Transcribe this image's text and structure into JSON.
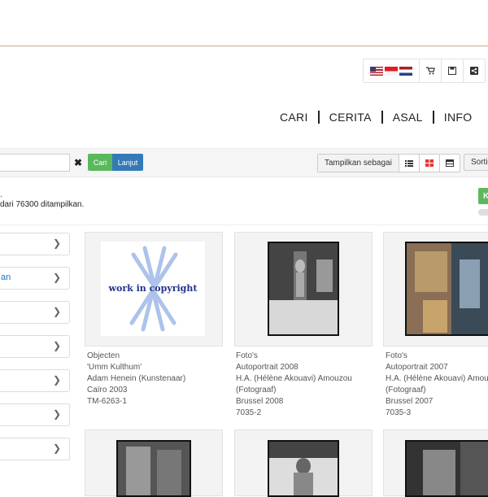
{
  "toolbar": {
    "flags": [
      "us-flag",
      "indonesia-flag",
      "netherlands-flag"
    ],
    "icons": [
      "cart-icon",
      "save-icon",
      "share-icon"
    ]
  },
  "nav": {
    "items": [
      "CARI",
      "CERITA",
      "ASAL",
      "INFO"
    ]
  },
  "search": {
    "placeholder": "",
    "clear_label": "✖",
    "cari_label": "Cari",
    "lanjut_label": "Lanjut"
  },
  "view": {
    "label": "Tampilkan sebagai",
    "sort_label": "Sorti"
  },
  "results": {
    "prefix_dot": ".",
    "text": "dari 76300 ditampilkan.",
    "green_button": "K"
  },
  "facets": [
    {
      "label": ""
    },
    {
      "label": "an"
    },
    {
      "label": ""
    },
    {
      "label": ""
    },
    {
      "label": ""
    },
    {
      "label": ""
    },
    {
      "label": ""
    }
  ],
  "cards": [
    {
      "type": "Objecten",
      "title": "'Umm Kulthum'",
      "creator": "Adam Henein (Kunstenaar)",
      "creator2": "",
      "place_date": "Caïro 2003",
      "id": "TM-6263-1",
      "copyright_text": "work in copyright"
    },
    {
      "type": "Foto's",
      "title": "Autoportrait 2008",
      "creator": "H.A. (Hélène Akouavi) Amouzou",
      "creator2": "(Fotograaf)",
      "place_date": "Brussel 2008",
      "id": "7035-2"
    },
    {
      "type": "Foto's",
      "title": "Autoportrait 2007",
      "creator": "H.A. (Hélène Akouavi) Amouzou",
      "creator2": "(Fotograaf)",
      "place_date": "Brussel 2007",
      "id": "7035-3"
    }
  ],
  "colors": {
    "green": "#5cb85c",
    "blue": "#337ab7",
    "accent_red": "#e53935",
    "link_blue": "#1a73c8"
  }
}
